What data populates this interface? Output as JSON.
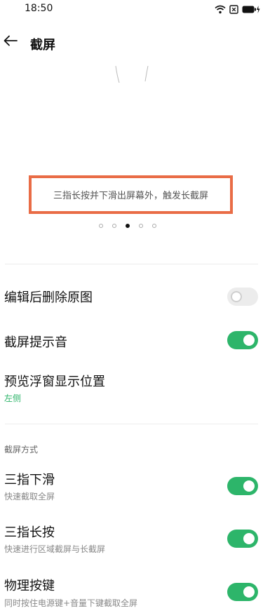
{
  "status": {
    "time": "18:50"
  },
  "header": {
    "title": "截屏"
  },
  "preview": {
    "caption": "三指长按并下滑出屏幕外，触发长截屏",
    "page_count": 5,
    "active_page": 3
  },
  "settings": {
    "delete_original": {
      "title": "编辑后删除原图",
      "enabled": false
    },
    "screenshot_sound": {
      "title": "截屏提示音",
      "enabled": true
    },
    "float_position": {
      "title": "预览浮窗显示位置",
      "value": "左侧"
    }
  },
  "methods_section": {
    "label": "截屏方式",
    "three_finger_swipe": {
      "title": "三指下滑",
      "subtitle": "快速截取全屏",
      "enabled": true
    },
    "three_finger_hold": {
      "title": "三指长按",
      "subtitle": "快速进行区域截屏与长截屏",
      "enabled": true
    },
    "physical_keys": {
      "title": "物理按键",
      "subtitle": "同时按住电源键+音量下键截取全屏",
      "enabled": true
    }
  },
  "colors": {
    "accent": "#2db56a",
    "highlight_box": "#e96c46"
  }
}
